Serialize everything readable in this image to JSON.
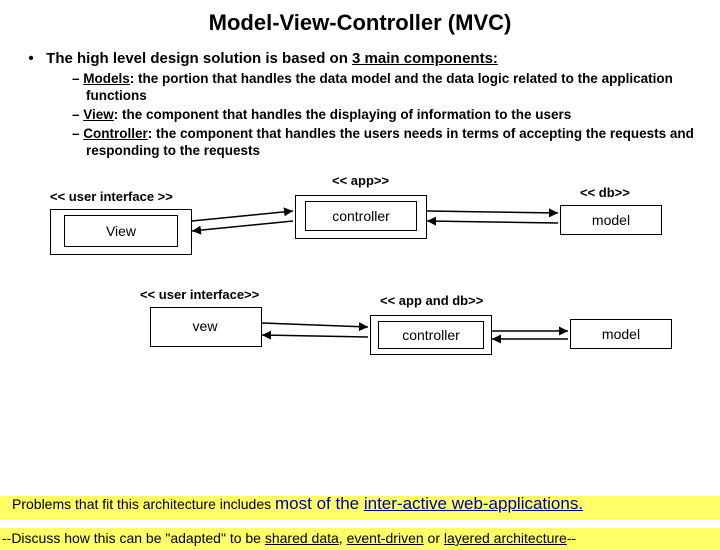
{
  "title": "Model-View-Controller (MVC)",
  "intro_prefix": "The high level design solution is based on ",
  "intro_underlined": "3 main components:",
  "items": [
    {
      "term": "Models",
      "desc": ": the portion that handles the data model and the data logic related to the application functions"
    },
    {
      "term": "View",
      "desc": ": the component that handles the displaying of information to the users"
    },
    {
      "term": "Controller",
      "desc": ": the component that handles the users needs in terms of accepting the requests and responding to the requests"
    }
  ],
  "d1": {
    "ui_label": "<< user interface >>",
    "app_label": "<< app>>",
    "db_label": "<< db>>",
    "view": "View",
    "controller": "controller",
    "model": "model"
  },
  "d2": {
    "ui_label": "<< user interface>>",
    "appdb_label": "<< app and db>>",
    "view": "vew",
    "controller": "controller",
    "model": "model"
  },
  "footer1_a": "Problems that fit this architecture includes ",
  "footer1_b": "most of the ",
  "footer1_c": "inter-active web-applications.",
  "footer2_a": "--Discuss how this can be \"adapted\" to be ",
  "footer2_b": "shared data",
  "footer2_c": "event-driven",
  "footer2_d": "layered architecture",
  "footer2_sep1": ", ",
  "footer2_sep2": " or ",
  "footer2_end": "--"
}
